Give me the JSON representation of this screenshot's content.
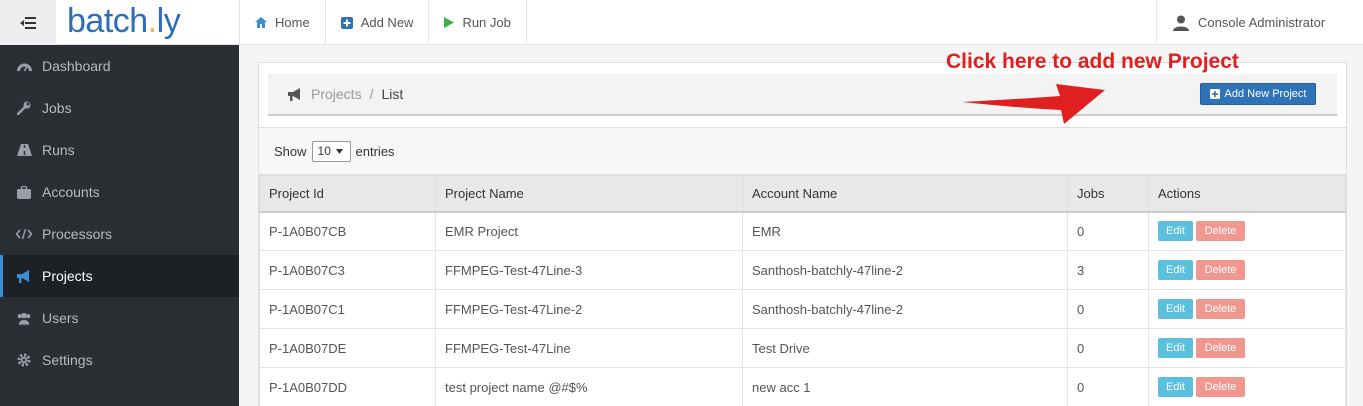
{
  "app": {
    "logo_main": "batch",
    "logo_dot": ".",
    "logo_tail": "ly"
  },
  "topnav": [
    {
      "label": "Home",
      "icon": "home-icon"
    },
    {
      "label": "Add New",
      "icon": "plus-square-icon"
    },
    {
      "label": "Run Job",
      "icon": "play-icon"
    }
  ],
  "user": {
    "name": "Console Administrator",
    "icon": "user-icon"
  },
  "sidebar": {
    "items": [
      {
        "label": "Dashboard",
        "icon": "dashboard-icon"
      },
      {
        "label": "Jobs",
        "icon": "wrench-icon"
      },
      {
        "label": "Runs",
        "icon": "road-icon"
      },
      {
        "label": "Accounts",
        "icon": "briefcase-icon"
      },
      {
        "label": "Processors",
        "icon": "code-icon"
      },
      {
        "label": "Projects",
        "icon": "bullhorn-icon",
        "active": true
      },
      {
        "label": "Users",
        "icon": "users-icon"
      },
      {
        "label": "Settings",
        "icon": "gear-icon"
      }
    ]
  },
  "breadcrumb": {
    "parent": "Projects",
    "separator": "/",
    "current": "List"
  },
  "add_button": {
    "label": "Add New Project"
  },
  "annotation": {
    "text": "Click here to add new Project"
  },
  "table_controls": {
    "show_label": "Show",
    "entries_value": "10",
    "entries_label": "entries"
  },
  "table": {
    "columns": [
      "Project Id",
      "Project Name",
      "Account Name",
      "Jobs",
      "Actions"
    ],
    "rows": [
      {
        "id": "P-1A0B07CB",
        "name": "EMR Project",
        "account": "EMR",
        "jobs": "0"
      },
      {
        "id": "P-1A0B07C3",
        "name": "FFMPEG-Test-47Line-3",
        "account": "Santhosh-batchly-47line-2",
        "jobs": "3"
      },
      {
        "id": "P-1A0B07C1",
        "name": "FFMPEG-Test-47Line-2",
        "account": "Santhosh-batchly-47line-2",
        "jobs": "0"
      },
      {
        "id": "P-1A0B07DE",
        "name": "FFMPEG-Test-47Line",
        "account": "Test Drive",
        "jobs": "0"
      },
      {
        "id": "P-1A0B07DD",
        "name": "test project name @#$%",
        "account": "new acc 1",
        "jobs": "0"
      }
    ],
    "edit_label": "Edit",
    "delete_label": "Delete"
  },
  "colors": {
    "brand": "#2c6fb7",
    "sidebar_bg": "#2b2f33",
    "annotation": "#e02020",
    "edit": "#5bc0de",
    "delete": "#f0978f"
  }
}
